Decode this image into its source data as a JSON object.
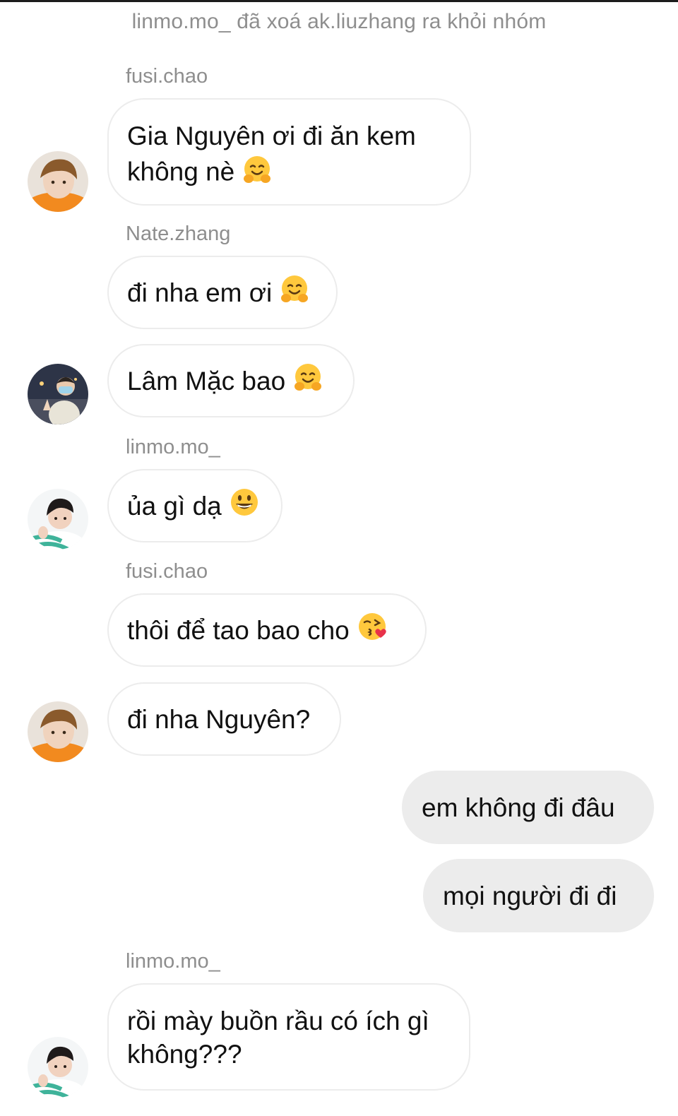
{
  "chat": {
    "system_notice": "linmo.mo_ đã xoá ak.liuzhang ra khỏi nhóm",
    "messages": [
      {
        "sender": "fusi.chao",
        "line1": "Gia Nguyên ơi đi ăn kem",
        "line2": "không nè",
        "emoji": "hugging-face-emoji"
      },
      {
        "sender": "Nate.zhang",
        "text": "đi nha em ơi",
        "emoji": "hugging-face-emoji"
      },
      {
        "text": "Lâm Mặc bao",
        "emoji": "hugging-face-emoji"
      },
      {
        "sender": "linmo.mo_",
        "text": "ủa gì dạ",
        "emoji": "grinning-face-emoji"
      },
      {
        "sender": "fusi.chao",
        "text": "thôi để tao bao cho",
        "emoji": "face-blowing-kiss-emoji"
      },
      {
        "text": "đi nha Nguyên?"
      },
      {
        "text": "em không đi đâu"
      },
      {
        "text": "mọi người đi đi"
      },
      {
        "sender": "linmo.mo_",
        "line1": "rồi mày buồn rầu có ích gì",
        "line2": "không???"
      }
    ]
  },
  "colors": {
    "incoming_bubble": "#ffffff",
    "incoming_border": "#ececec",
    "outgoing_bubble": "#ececec",
    "meta_text": "#8e8e8e",
    "message_text": "#111111"
  }
}
